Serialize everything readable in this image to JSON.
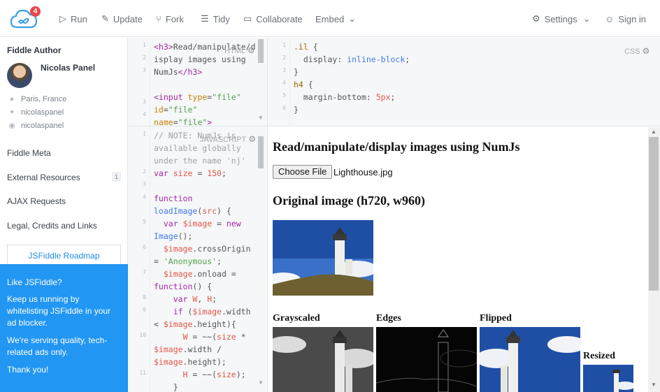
{
  "topbar": {
    "notification_count": "4",
    "run": "Run",
    "update": "Update",
    "fork": "Fork",
    "tidy": "Tidy",
    "collaborate": "Collaborate",
    "embed": "Embed",
    "settings": "Settings",
    "signin": "Sign in"
  },
  "sidebar": {
    "author_heading": "Fiddle Author",
    "author_name": "Nicolas Panel",
    "location": "Paris, France",
    "twitter": "nicolaspanel",
    "github": "nicolaspanel",
    "links": [
      "Fiddle Meta",
      "External Resources",
      "AJAX Requests",
      "Legal, Credits and Links"
    ],
    "external_count": "1",
    "roadmap": "JSFiddle Roadmap",
    "promo": {
      "title": "Like JSFiddle?",
      "p1": "Keep us running by whitelisting JSFiddle in your ad blocker.",
      "p2": "We're serving quality, tech-related ads only.",
      "p3": "Thank you!"
    }
  },
  "panels": {
    "html_label": "HTML",
    "css_label": "CSS",
    "js_label": "JAVASCRIPT"
  },
  "result": {
    "title": "Read/manipulate/display images using NumJs",
    "choose_file": "Choose File",
    "file_name": "Lighthouse.jpg",
    "original_title": "Original image (h720, w960)",
    "grayscaled": "Grayscaled",
    "edges": "Edges",
    "flipped": "Flipped",
    "resized": "Resized"
  },
  "colors": {
    "accent": "#2196f3",
    "badge": "#e8484a"
  }
}
